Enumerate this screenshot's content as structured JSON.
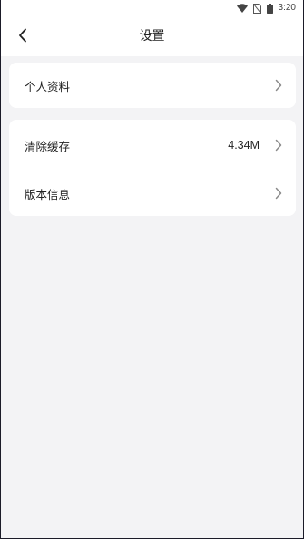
{
  "status_bar": {
    "time": "3:20",
    "icons": [
      "wifi-icon",
      "no-sim-icon",
      "battery-icon"
    ]
  },
  "header": {
    "back_icon": "chevron-left-icon",
    "title": "设置"
  },
  "settings": {
    "group1": [
      {
        "label": "个人资料",
        "icon": "chevron-right-icon"
      }
    ],
    "group2": [
      {
        "label": "清除缓存",
        "value": "4.34M",
        "icon": "chevron-right-icon"
      },
      {
        "label": "版本信息",
        "icon": "chevron-right-icon"
      }
    ]
  },
  "colors": {
    "background": "#f3f3f5",
    "card": "#ffffff",
    "text": "#222222",
    "chevron": "#8a8a8a"
  }
}
